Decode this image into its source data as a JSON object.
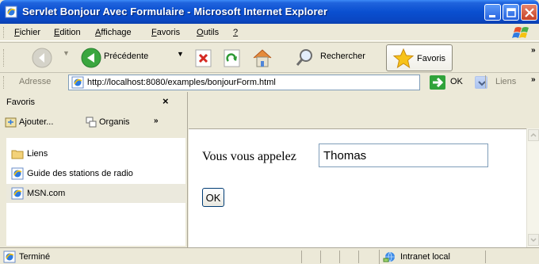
{
  "window": {
    "title": "Servlet Bonjour Avec Formulaire - Microsoft Internet Explorer",
    "icons": {
      "app": "ie-page-icon",
      "minimize": "minimize-icon",
      "maximize": "maximize-icon",
      "close": "close-icon"
    }
  },
  "menu": {
    "items": [
      "Fichier",
      "Edition",
      "Affichage",
      "Favoris",
      "Outils",
      "?"
    ]
  },
  "toolbar": {
    "back_label": "Précédente",
    "search_label": "Rechercher",
    "favorites_label": "Favoris",
    "more": "»"
  },
  "address": {
    "label": "Adresse",
    "url": "http://localhost:8080/examples/bonjourForm.html",
    "go_label": "OK",
    "links_label": "Liens",
    "more": "»"
  },
  "favorites": {
    "title": "Favoris",
    "close": "×",
    "add_label": "Ajouter...",
    "organize_label": "Organis",
    "more": "»",
    "items": [
      {
        "label": "Liens",
        "icon": "folder-icon"
      },
      {
        "label": "Guide des stations de radio",
        "icon": "ie-page-icon"
      },
      {
        "label": "MSN.com",
        "icon": "ie-page-icon"
      }
    ]
  },
  "page": {
    "prompt": "Vous vous appelez",
    "name_value": "Thomas",
    "ok_label": "OK"
  },
  "status": {
    "text": "Terminé",
    "zone": "Intranet local"
  },
  "colors": {
    "titlebar": "#0a4fd0",
    "chrome": "#ece9d8",
    "go_green": "#30a33a",
    "selected_row": "#ebe9dd"
  }
}
